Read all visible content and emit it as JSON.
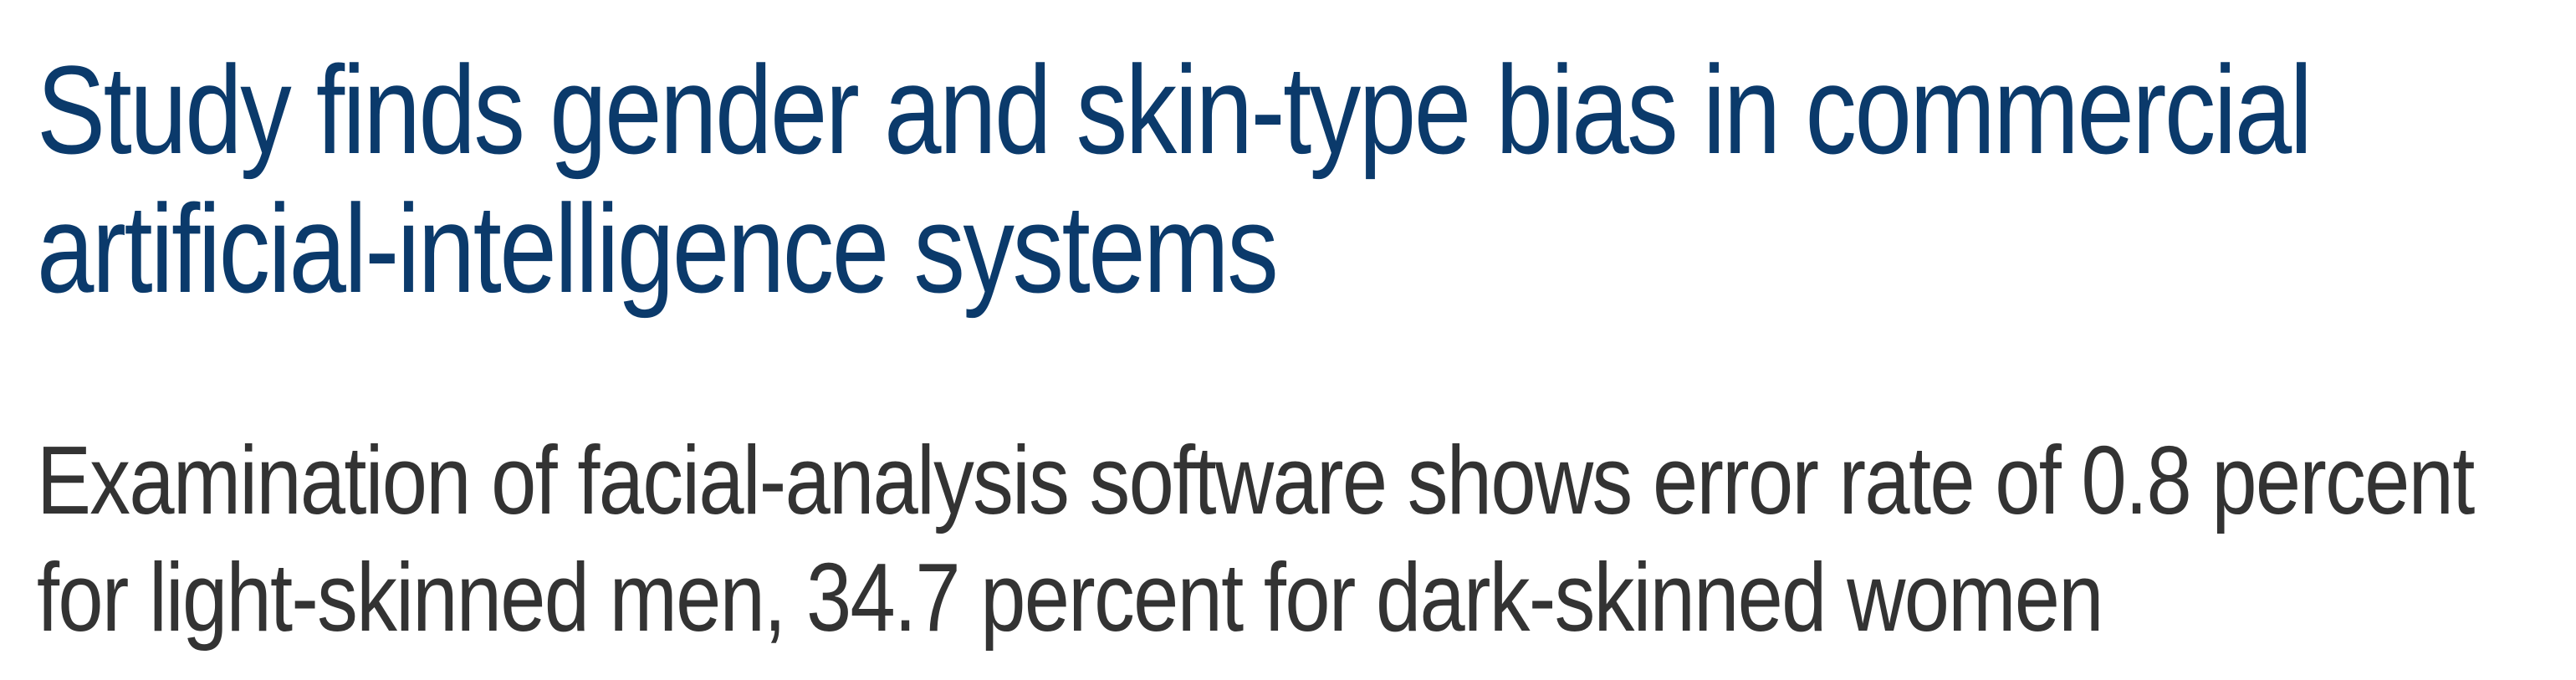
{
  "article": {
    "headline": "Study finds gender and skin-type bias in commercial artificial-intelligence systems",
    "subheadline": "Examination of facial-analysis software shows error rate of 0.8 percent for light-skinned men, 34.7 percent for dark-skinned women"
  },
  "colors": {
    "headline": "#0b3a6b",
    "subheadline": "#333333",
    "background": "#ffffff"
  }
}
